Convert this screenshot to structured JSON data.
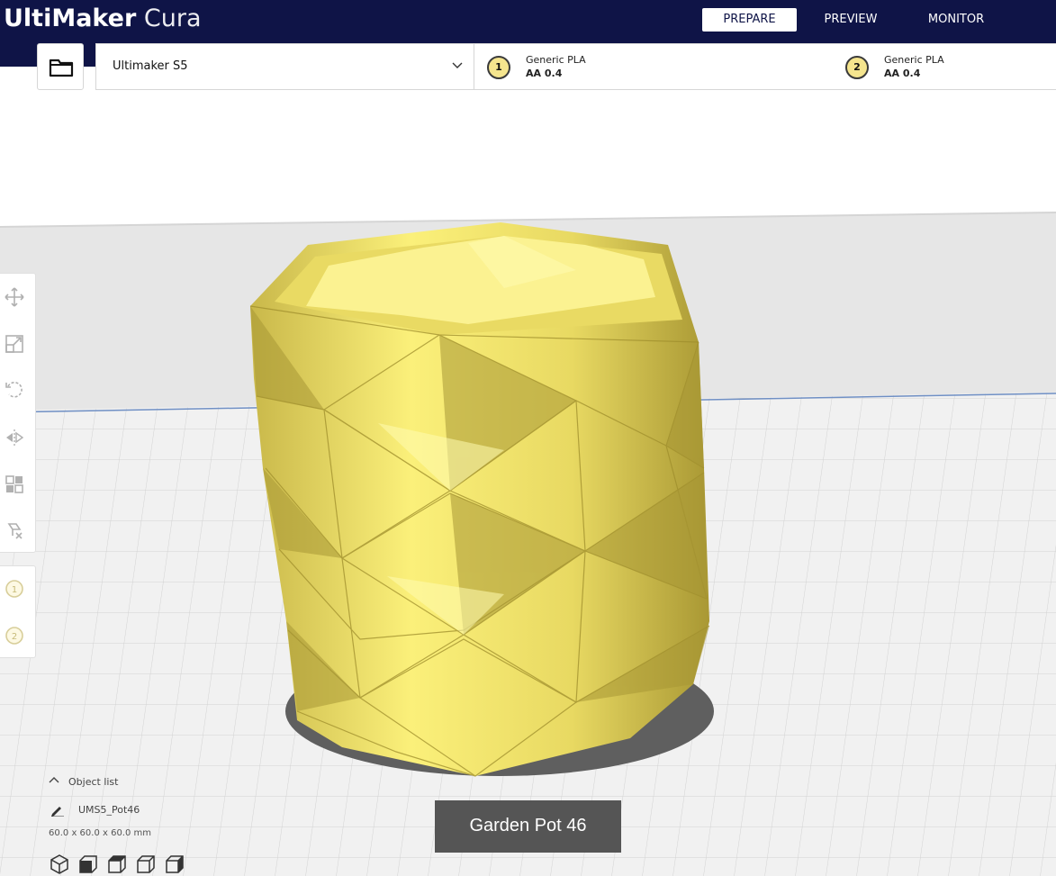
{
  "app": {
    "logo_bold": "UltiMaker",
    "logo_light": " Cura"
  },
  "stages": [
    {
      "label": "PREPARE",
      "active": true
    },
    {
      "label": "PREVIEW",
      "active": false
    },
    {
      "label": "MONITOR",
      "active": false
    }
  ],
  "machine": {
    "name": "Ultimaker S5"
  },
  "extruders": [
    {
      "number": "1",
      "material": "Generic PLA",
      "nozzle": "AA 0.4"
    },
    {
      "number": "2",
      "material": "Generic PLA",
      "nozzle": "AA 0.4"
    }
  ],
  "toolbar": {
    "tools": [
      "move-icon",
      "scale-icon",
      "rotate-icon",
      "mirror-icon",
      "per-model-settings-icon",
      "support-blocker-icon"
    ],
    "extruder_buttons": [
      "1",
      "2"
    ]
  },
  "object_list": {
    "toggle_label": "Object list",
    "object_name": "UMS5_Pot46",
    "dimensions": "60.0 x 60.0 x 60.0 mm"
  },
  "view_buttons": [
    "3d-view-icon",
    "front-view-icon",
    "top-view-icon",
    "left-view-icon",
    "right-view-icon"
  ],
  "caption": "Garden Pot 46",
  "colors": {
    "header": "#0f1447",
    "model": "#f3e66c",
    "build_plate": "#f0f0f0",
    "grid": "#cfcfcf"
  }
}
